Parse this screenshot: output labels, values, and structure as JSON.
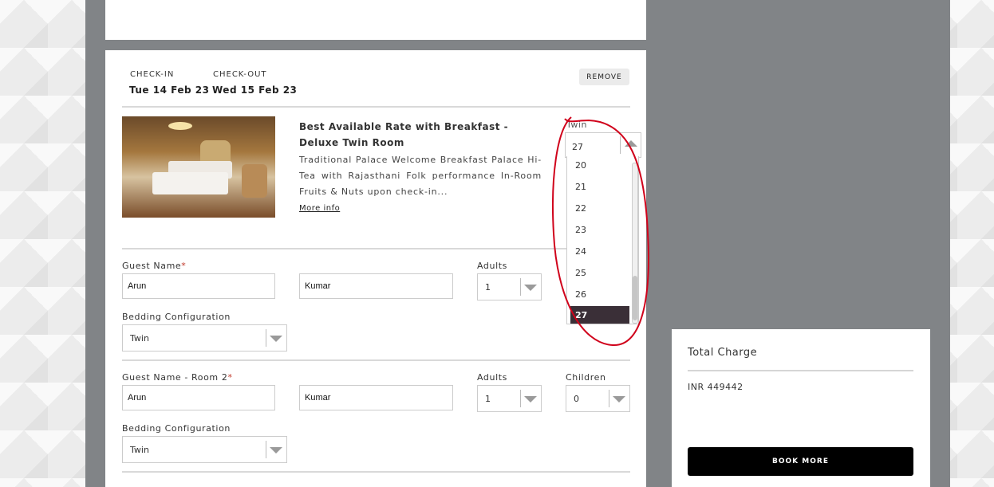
{
  "stay": {
    "checkin_label": "CHECK-IN",
    "checkin_date": "Tue 14 Feb 23",
    "checkout_label": "CHECK-OUT",
    "checkout_date": "Wed 15 Feb 23",
    "remove_label": "REMOVE"
  },
  "room": {
    "title": "Best Available Rate with Breakfast - Deluxe Twin Room",
    "description": "Traditional Palace Welcome Breakfast Palace Hi-Tea with Rajasthani Folk performance In-Room Fruits & Nuts upon check-in...",
    "more_info": "More info"
  },
  "room1": {
    "guest_label": "Guest Name",
    "required_mark": "*",
    "first_name": "Arun",
    "last_name": "Kumar",
    "adults_label": "Adults",
    "adults_value": "1",
    "bedding_label": "Bedding Configuration",
    "bedding_value": "Twin"
  },
  "room2": {
    "guest_label": "Guest Name - Room 2",
    "required_mark": "*",
    "first_name": "Arun",
    "last_name": "Kumar",
    "adults_label": "Adults",
    "adults_value": "1",
    "children_label": "Children",
    "children_value": "0",
    "bedding_label": "Bedding Configuration",
    "bedding_value": "Twin"
  },
  "children_dropdown": {
    "label": "Twin",
    "value": "27",
    "options": [
      "20",
      "21",
      "22",
      "23",
      "24",
      "25",
      "26",
      "27"
    ],
    "selected": "27"
  },
  "summary": {
    "title": "Total Charge",
    "amount": "INR 449442",
    "book_more": "BOOK MORE"
  },
  "colors": {
    "frame": "#818487",
    "selected_option": "#3a2f37",
    "annotation": "#d0021b",
    "required": "#c0392b"
  }
}
